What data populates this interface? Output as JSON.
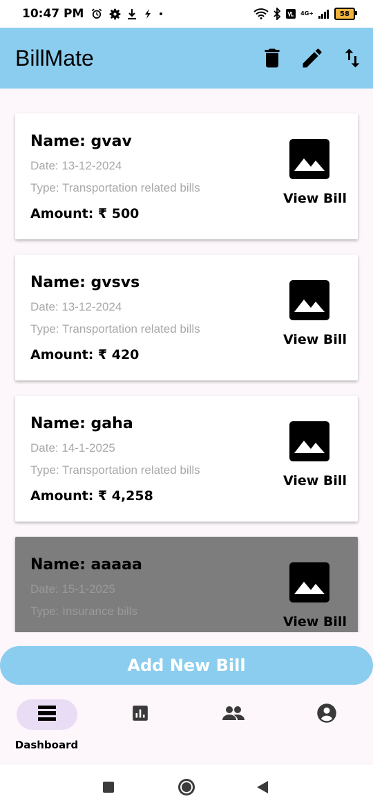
{
  "status": {
    "time": "10:47 PM",
    "network": "4G+",
    "battery": "58"
  },
  "appbar": {
    "title": "BillMate",
    "actions": [
      "delete-icon",
      "edit-icon",
      "sort-icon"
    ]
  },
  "bills": [
    {
      "name": "Name: gvav",
      "date": "Date: 13-12-2024",
      "type": "Type: Transportation related bills",
      "amount": "Amount: ₹  500",
      "view_label": "View Bill"
    },
    {
      "name": "Name: gvsvs",
      "date": "Date: 13-12-2024",
      "type": "Type: Transportation related bills",
      "amount": "Amount: ₹  420",
      "view_label": "View Bill"
    },
    {
      "name": "Name: gaha",
      "date": "Date: 14-1-2025",
      "type": "Type: Transportation related bills",
      "amount": "Amount: ₹  4,258",
      "view_label": "View Bill"
    },
    {
      "name": "Name: aaaaa",
      "date": "Date: 15-1-2025",
      "type": "Type: Insurance bills",
      "amount": "",
      "view_label": "View Bill"
    }
  ],
  "add_button": {
    "label": "Add New Bill"
  },
  "nav": {
    "items": [
      {
        "label": "Dashboard",
        "icon": "dashboard-icon",
        "active": true
      },
      {
        "label": "",
        "icon": "chart-icon",
        "active": false
      },
      {
        "label": "",
        "icon": "people-icon",
        "active": false
      },
      {
        "label": "",
        "icon": "account-icon",
        "active": false
      }
    ]
  },
  "colors": {
    "accent": "#8bcdee",
    "nav_pill": "#e8ddf4",
    "background": "#fdf6fb"
  }
}
